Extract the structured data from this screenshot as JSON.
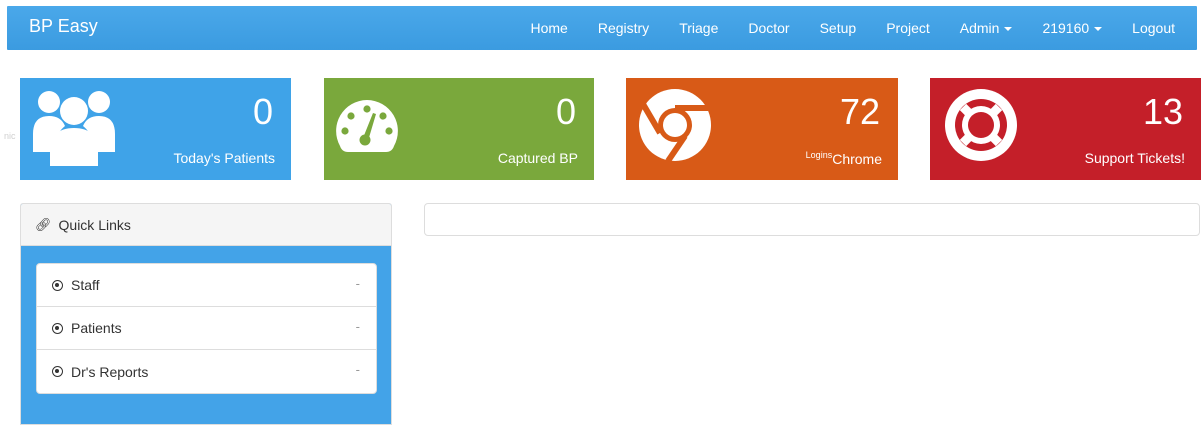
{
  "navbar": {
    "brand": "BP Easy",
    "items": [
      {
        "label": "Home"
      },
      {
        "label": "Registry"
      },
      {
        "label": "Triage"
      },
      {
        "label": "Doctor"
      },
      {
        "label": "Setup"
      },
      {
        "label": "Project"
      },
      {
        "label": "Admin",
        "dropdown": true
      },
      {
        "label": "219160",
        "dropdown": true
      },
      {
        "label": "Logout"
      }
    ]
  },
  "cards": [
    {
      "value": "0",
      "label": "Today's Patients",
      "icon": "users-icon",
      "color": "#3fa3e8"
    },
    {
      "value": "0",
      "label": "Captured BP",
      "icon": "dashboard-gauge-icon",
      "color": "#7aa83c"
    },
    {
      "value": "72",
      "label_sup": "Logins",
      "label": "Chrome",
      "icon": "chrome-icon",
      "color": "#d85a17"
    },
    {
      "value": "13",
      "label": "Support Tickets!",
      "icon": "life-ring-icon",
      "color": "#c41f29"
    }
  ],
  "ghost_text": "nic",
  "quick_links": {
    "title": "Quick Links",
    "items": [
      {
        "label": "Staff",
        "trail": "-"
      },
      {
        "label": "Patients",
        "trail": "-"
      },
      {
        "label": "Dr's Reports",
        "trail": "-"
      }
    ]
  }
}
